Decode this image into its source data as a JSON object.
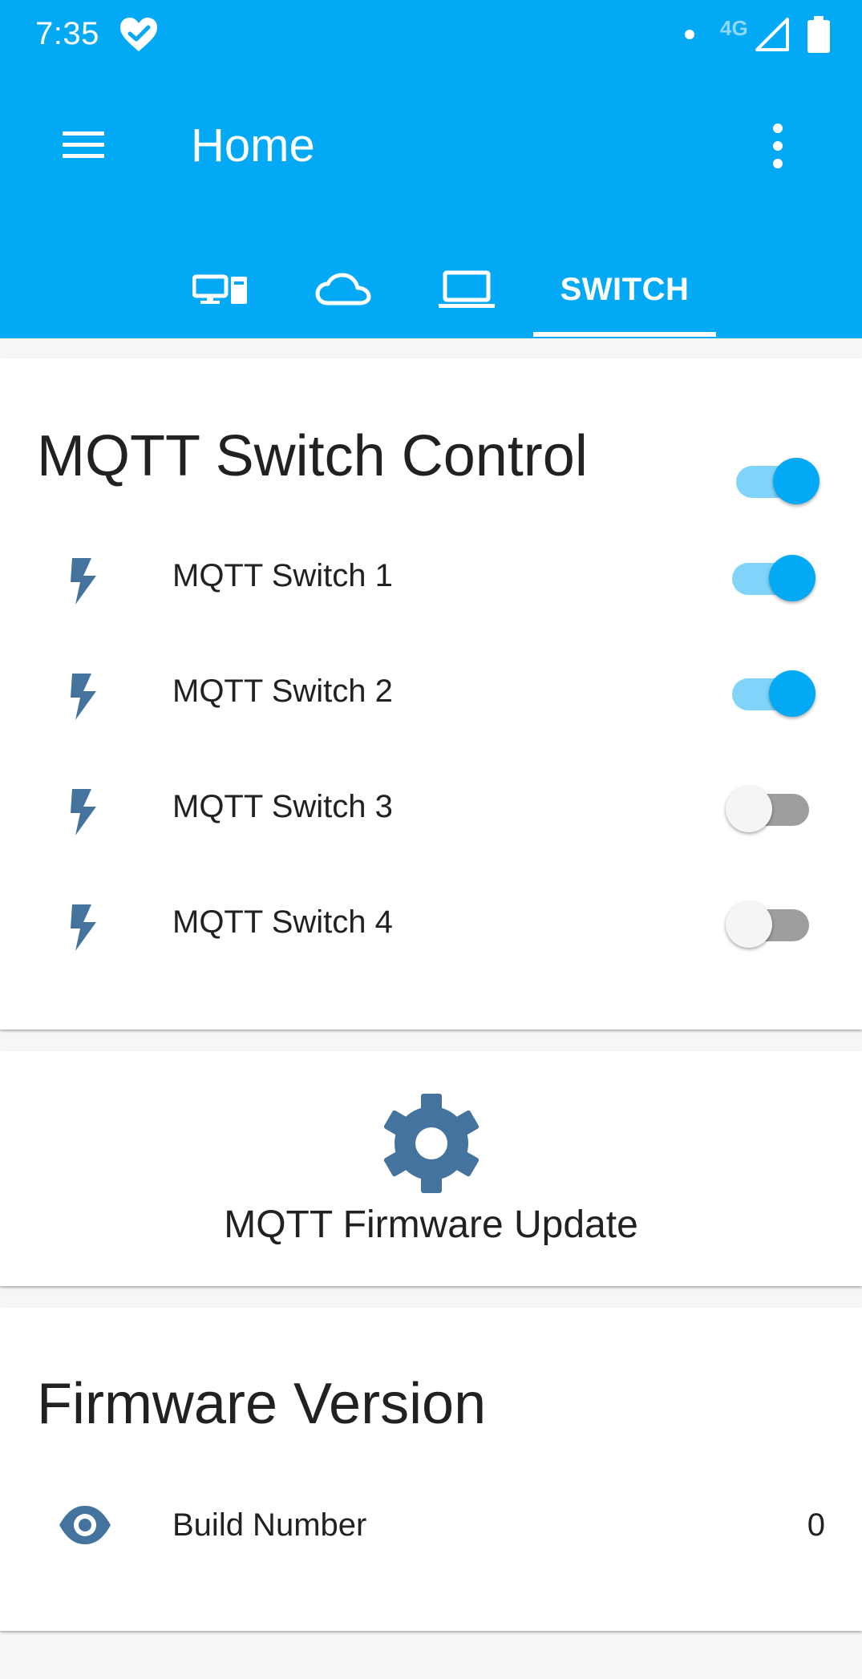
{
  "status_bar": {
    "time": "7:35",
    "network": "4G",
    "icons": [
      "heart-check-icon",
      "notification-dot-icon",
      "cell-signal-icon",
      "battery-icon"
    ]
  },
  "toolbar": {
    "title": "Home",
    "menu_icon": "hamburger-menu-icon",
    "overflow_icon": "more-vertical-icon"
  },
  "tabs": [
    {
      "icon": "devices-icon",
      "label": ""
    },
    {
      "icon": "cloud-icon",
      "label": ""
    },
    {
      "icon": "laptop-icon",
      "label": ""
    },
    {
      "icon": "",
      "label": "SWITCH",
      "selected": true
    }
  ],
  "switch_card": {
    "title": "MQTT Switch Control",
    "master_on": true,
    "rows": [
      {
        "label": "MQTT Switch 1",
        "on": true,
        "icon": "flash-icon"
      },
      {
        "label": "MQTT Switch 2",
        "on": true,
        "icon": "flash-icon"
      },
      {
        "label": "MQTT Switch 3",
        "on": false,
        "icon": "flash-icon"
      },
      {
        "label": "MQTT Switch 4",
        "on": false,
        "icon": "flash-icon"
      }
    ]
  },
  "firmware_update_card": {
    "label": "MQTT Firmware Update",
    "icon": "gear-icon"
  },
  "version_card": {
    "title": "Firmware Version",
    "row_label": "Build Number",
    "row_value": "0",
    "row_icon": "eye-icon"
  },
  "colors": {
    "primary": "#03a9f4",
    "icon": "#44739e",
    "toggle_track_on": "#80d4f9",
    "toggle_track_off": "#9e9e9e"
  }
}
